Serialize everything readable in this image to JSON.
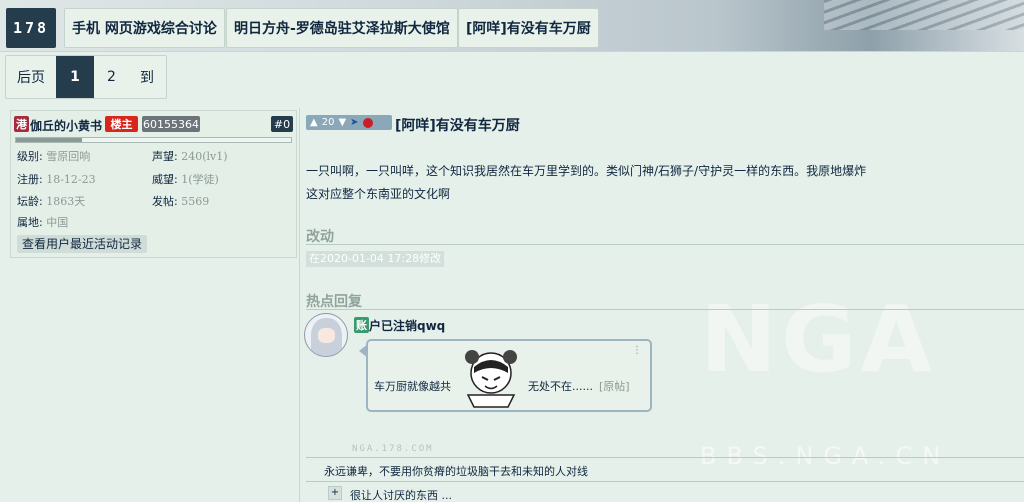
{
  "header": {
    "logo": "178",
    "breadcrumbs": [
      "手机 网页游戏综合讨论",
      "明日方舟-罗德岛驻艾泽拉斯大使馆",
      "[阿咩]有没有车万厨"
    ]
  },
  "pager": {
    "back": "后页",
    "current": "1",
    "page2": "2",
    "goto": "到"
  },
  "user": {
    "avatar_tag": "港",
    "name": "伽丘的小黄书",
    "role": "楼主",
    "uid": "60155364",
    "floor": "#0",
    "stats": {
      "level_label": "级别:",
      "level_value": "雪原回响",
      "rep_label": "声望:",
      "rep_value": "240(lv1)",
      "reg_label": "注册:",
      "reg_value": "18-12-23",
      "prestige_label": "威望:",
      "prestige_value": "1(学徒)",
      "age_label": "坛龄:",
      "age_value": "1863天",
      "posts_label": "发帖:",
      "posts_value": "5569",
      "loc_label": "属地:",
      "loc_value": "中国"
    },
    "activity_button": "查看用户最近活动记录"
  },
  "post": {
    "votes": "20",
    "title": "[阿咩]有没有车万厨",
    "line1": "一只叫啊，一只叫咩，这个知识我居然在车万里学到的。类似门神/石狮子/守护灵一样的东西。我原地爆炸",
    "line2": "这对应整个东南亚的文化啊",
    "edit_heading": "改动",
    "edit_note": "在2020-01-04 17:28修改",
    "hot_heading": "热点回复",
    "reply": {
      "tag": "账",
      "user": "户已注销qwq",
      "text_before": "车万厨就像越共",
      "text_after": "无处不在......",
      "source": "[原帖]"
    },
    "footer_mark": "NGA.178.COM",
    "signature": "永远谦卑，不要用你贫瘠的垃圾脑干去和未知的人对线",
    "collapsed_prefix": "+",
    "collapsed_text": "很让人讨厌的东西 ..."
  },
  "watermark": {
    "logo": "NGA",
    "url": "BBS.NGA.CN"
  },
  "colors": {
    "dark": "#243c4c",
    "bg": "#e6f0ea",
    "role": "#d9261c",
    "tag_user": "#a9293f",
    "tag_reply": "#3a9a6e"
  }
}
